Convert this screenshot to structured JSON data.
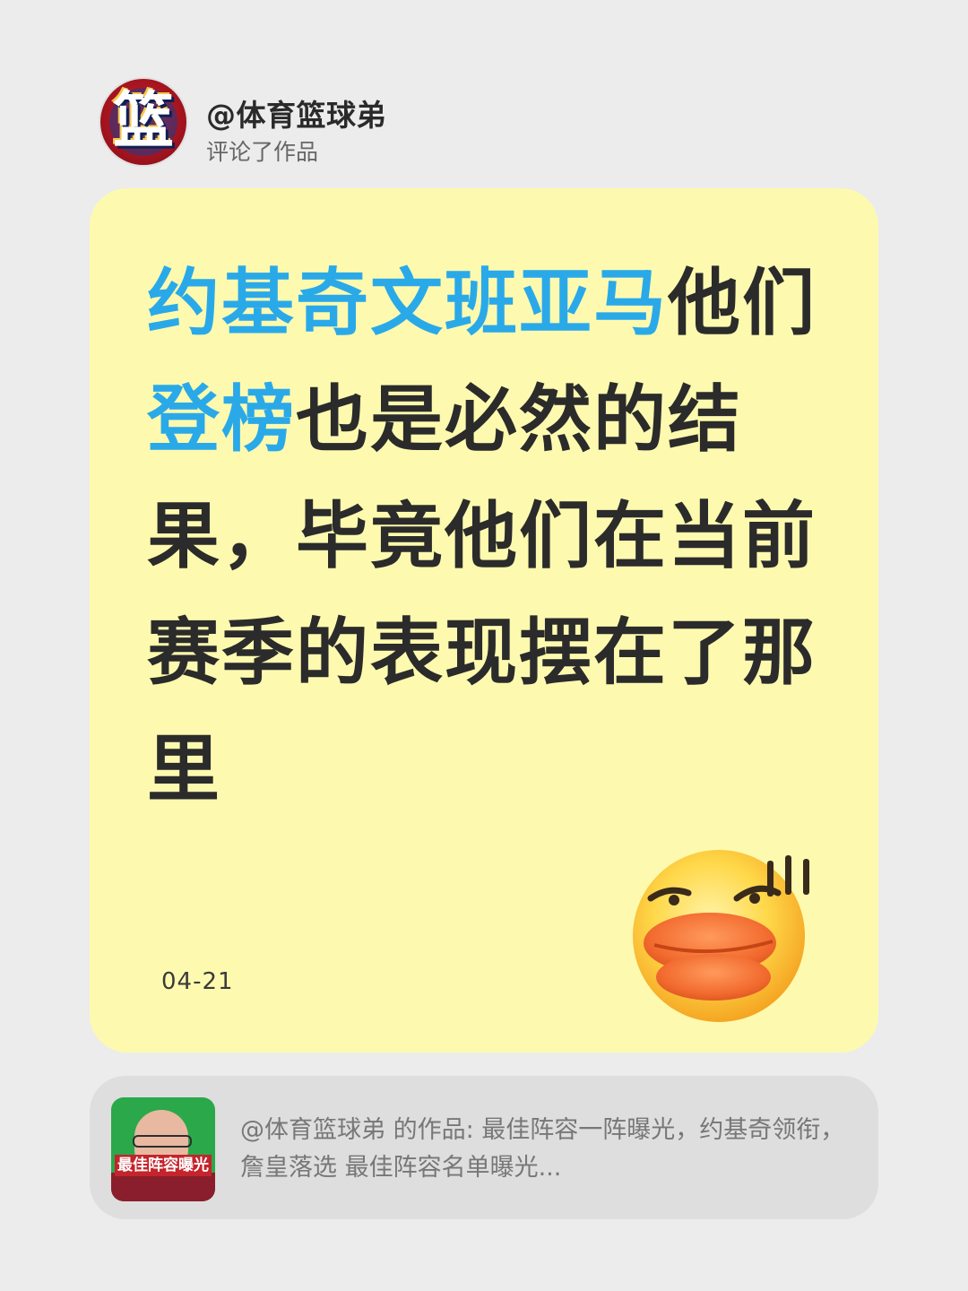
{
  "author": {
    "username": "@体育篮球弟",
    "action": "评论了作品",
    "avatar_icon": "lan-logo-icon",
    "avatar_glyph": "篮",
    "avatar_colors": {
      "primary": "#c61f2c",
      "secondary": "#1f3c8a",
      "accent": "#f5c94a"
    }
  },
  "comment": {
    "segments": [
      {
        "text": "约基奇文班亚马",
        "highlight": true
      },
      {
        "text": "他们",
        "highlight": false
      },
      {
        "text": "登榜",
        "highlight": true
      },
      {
        "text": "也是必然的结果，毕竟他们在当前赛季的表现摆在了那里",
        "highlight": false
      }
    ],
    "date": "04-21",
    "card_color": "#fdfaaf",
    "highlight_color": "#2aa9e9",
    "emoji": "duck-face-emoji"
  },
  "source": {
    "thumbnail_caption": "最佳阵容曝光",
    "text": "@体育篮球弟 的作品: 最佳阵容一阵曝光，约基奇领衔，詹皇落选 最佳阵容名单曝光..."
  }
}
